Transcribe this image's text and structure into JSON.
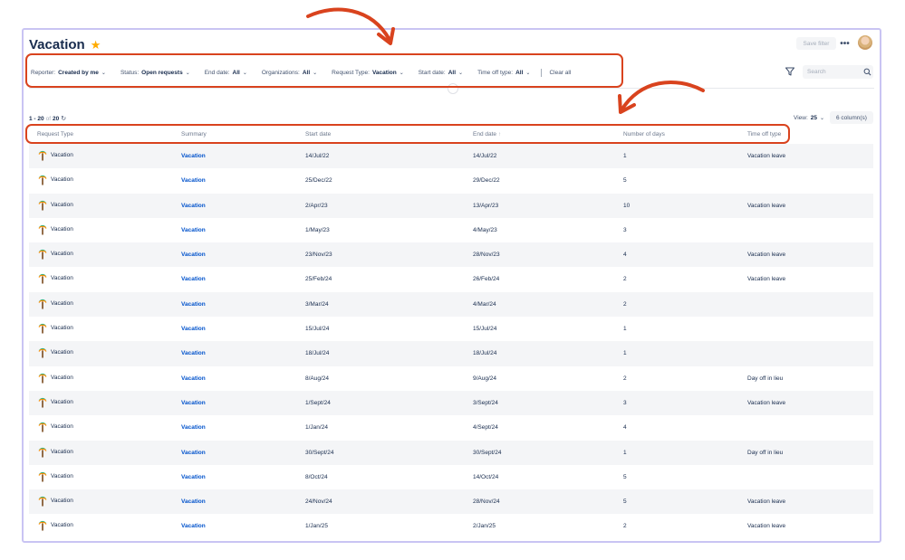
{
  "header": {
    "title": "Vacation",
    "save_filter_label": "Save filter",
    "more_label": "•••"
  },
  "filters": [
    {
      "label": "Reporter:",
      "value": "Created by me"
    },
    {
      "label": "Status:",
      "value": "Open requests"
    },
    {
      "label": "End date:",
      "value": "All"
    },
    {
      "label": "Organizations:",
      "value": "All"
    },
    {
      "label": "Request Type:",
      "value": "Vacation"
    },
    {
      "label": "Start date:",
      "value": "All"
    },
    {
      "label": "Time off type:",
      "value": "All"
    }
  ],
  "clear_all_label": "Clear all",
  "search": {
    "placeholder": "Search"
  },
  "results": {
    "range": "1 - 20",
    "of_label": "of",
    "total": "20"
  },
  "view": {
    "label": "View:",
    "value": "25"
  },
  "columns_button_label": "6 column(s)",
  "table": {
    "headers": [
      "Request Type",
      "Summary",
      "Start date",
      "End date",
      "Number of days",
      "Time off type"
    ],
    "rows": [
      {
        "type": "Vacation",
        "summary": "Vacation",
        "start": "14/Jul/22",
        "end": "14/Jul/22",
        "days": "1",
        "time_off": "Vacation leave"
      },
      {
        "type": "Vacation",
        "summary": "Vacation",
        "start": "25/Dec/22",
        "end": "29/Dec/22",
        "days": "5",
        "time_off": ""
      },
      {
        "type": "Vacation",
        "summary": "Vacation",
        "start": "2/Apr/23",
        "end": "13/Apr/23",
        "days": "10",
        "time_off": "Vacation leave"
      },
      {
        "type": "Vacation",
        "summary": "Vacation",
        "start": "1/May/23",
        "end": "4/May/23",
        "days": "3",
        "time_off": ""
      },
      {
        "type": "Vacation",
        "summary": "Vacation",
        "start": "23/Nov/23",
        "end": "28/Nov/23",
        "days": "4",
        "time_off": "Vacation leave"
      },
      {
        "type": "Vacation",
        "summary": "Vacation",
        "start": "25/Feb/24",
        "end": "26/Feb/24",
        "days": "2",
        "time_off": "Vacation leave"
      },
      {
        "type": "Vacation",
        "summary": "Vacation",
        "start": "3/Mar/24",
        "end": "4/Mar/24",
        "days": "2",
        "time_off": ""
      },
      {
        "type": "Vacation",
        "summary": "Vacation",
        "start": "15/Jul/24",
        "end": "15/Jul/24",
        "days": "1",
        "time_off": ""
      },
      {
        "type": "Vacation",
        "summary": "Vacation",
        "start": "18/Jul/24",
        "end": "18/Jul/24",
        "days": "1",
        "time_off": ""
      },
      {
        "type": "Vacation",
        "summary": "Vacation",
        "start": "8/Aug/24",
        "end": "9/Aug/24",
        "days": "2",
        "time_off": "Day off in lieu"
      },
      {
        "type": "Vacation",
        "summary": "Vacation",
        "start": "1/Sept/24",
        "end": "3/Sept/24",
        "days": "3",
        "time_off": "Vacation leave"
      },
      {
        "type": "Vacation",
        "summary": "Vacation",
        "start": "1/Jan/24",
        "end": "4/Sept/24",
        "days": "4",
        "time_off": ""
      },
      {
        "type": "Vacation",
        "summary": "Vacation",
        "start": "30/Sept/24",
        "end": "30/Sept/24",
        "days": "1",
        "time_off": "Day off in lieu"
      },
      {
        "type": "Vacation",
        "summary": "Vacation",
        "start": "8/Oct/24",
        "end": "14/Oct/24",
        "days": "5",
        "time_off": ""
      },
      {
        "type": "Vacation",
        "summary": "Vacation",
        "start": "24/Nov/24",
        "end": "28/Nov/24",
        "days": "5",
        "time_off": "Vacation leave"
      },
      {
        "type": "Vacation",
        "summary": "Vacation",
        "start": "1/Jan/25",
        "end": "2/Jan/25",
        "days": "2",
        "time_off": "Vacation leave"
      }
    ]
  },
  "colors": {
    "accent": "#0052cc",
    "annotation": "#d9431e",
    "frame_border": "#c9c4f3",
    "star": "#ffab00"
  }
}
